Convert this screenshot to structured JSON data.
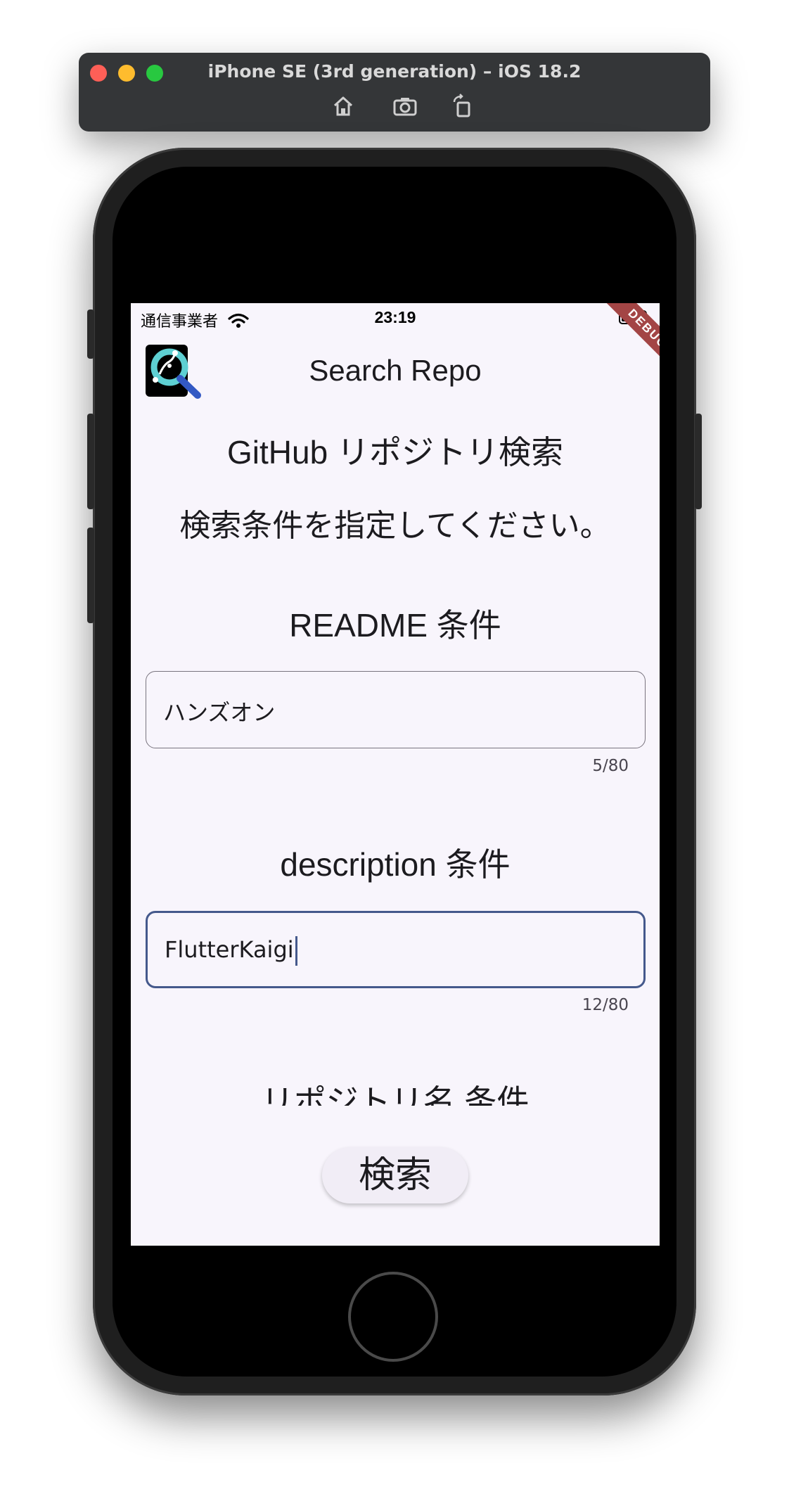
{
  "simulator": {
    "title": "iPhone SE (3rd generation) – iOS 18.2",
    "toolbar_icons": [
      "home-icon",
      "screenshot-icon",
      "rotate-icon"
    ]
  },
  "status_bar": {
    "carrier": "通信事業者",
    "time": "23:19"
  },
  "debug_banner": "DEBUG",
  "app_bar": {
    "title": "Search Repo"
  },
  "page": {
    "heading": "GitHub リポジトリ検索",
    "instruction": "検索条件を指定してください。"
  },
  "readme": {
    "label": "README 条件",
    "value": "ハンズオン",
    "counter": "5/80"
  },
  "description": {
    "label": "description 条件",
    "value": "FlutterKaigi",
    "counter": "12/80"
  },
  "repo_name": {
    "label": "リポジトリ名 条件"
  },
  "search_button": {
    "label": "検索"
  },
  "colors": {
    "screen_background": "#f8f5fc",
    "focused_border": "#45598c",
    "debug_ribbon": "#a34545"
  }
}
